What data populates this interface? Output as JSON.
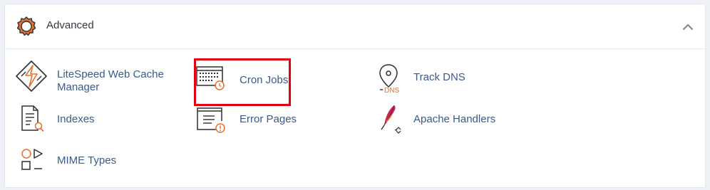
{
  "section": {
    "title": "Advanced",
    "icon": "gear-icon",
    "collapse_icon": "chevron-up-icon"
  },
  "items": [
    {
      "label": "LiteSpeed Web Cache Manager",
      "icon": "litespeed-icon"
    },
    {
      "label": "Cron Jobs",
      "icon": "cron-calendar-icon"
    },
    {
      "label": "Track DNS",
      "icon": "track-dns-icon",
      "icon_text": "DNS"
    },
    {
      "label": "Indexes",
      "icon": "indexes-icon"
    },
    {
      "label": "Error Pages",
      "icon": "error-pages-icon"
    },
    {
      "label": "Apache Handlers",
      "icon": "apache-feather-icon"
    },
    {
      "label": "MIME Types",
      "icon": "mime-types-icon"
    }
  ],
  "colors": {
    "accent_orange": "#e8702a",
    "link_blue": "#3b5a8c",
    "highlight_red": "#e3000f"
  }
}
